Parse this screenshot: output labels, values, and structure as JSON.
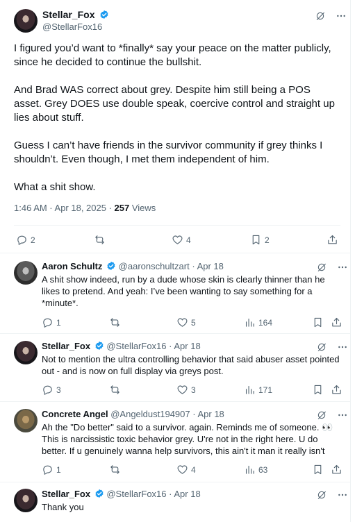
{
  "main_post": {
    "name": "Stellar_Fox",
    "handle": "@StellarFox16",
    "paragraphs": [
      "I figured you’d want to *finally* say your peace on the matter publicly, since he decided to continue the bullshit.",
      "And Brad WAS correct about grey. Despite him still being a POS asset. Grey DOES use double speak, coercive control and straight up lies about stuff.",
      "Guess I can’t have friends in the survivor community if grey thinks I shouldn’t. Even though, I met them independent of him.",
      "What a shit show."
    ],
    "timestamp": "1:46 AM · Apr 18, 2025 · ",
    "views_count": "257",
    "views_label": " Views",
    "replies": "2",
    "reposts": "",
    "likes": "4",
    "bookmarks": "2"
  },
  "replies": [
    {
      "name": "Aaron Schultz",
      "handle": "@aaronschultzart",
      "date": "· Apr 18",
      "text": "A shit show indeed, run by a dude whose skin is clearly thinner than he likes to pretend. And yeah: I’ve been wanting to say something for a *minute*.",
      "replies": "1",
      "reposts": "",
      "likes": "5",
      "views": "164"
    },
    {
      "name": "Stellar_Fox",
      "handle": "@StellarFox16",
      "date": "· Apr 18",
      "text": "Not to mention the ultra controlling behavior that said abuser asset pointed out - and is now on full display via greys post.",
      "replies": "3",
      "reposts": "",
      "likes": "3",
      "views": "171"
    },
    {
      "name": "Concrete Angel",
      "handle": "@Angeldust194907",
      "date": "· Apr 18",
      "text": "Ah the \"Do better\" said to a survivor. again. Reminds me of someone. 👀 This is narcissistic toxic behavior grey. U're not in the right here. U do better. If u genuinely wanna help survivors, this ain't it man it really isn't",
      "replies": "1",
      "reposts": "",
      "likes": "4",
      "views": "63"
    },
    {
      "name": "Stellar_Fox",
      "handle": "@StellarFox16",
      "date": "· Apr 18",
      "text": "Thank you"
    }
  ],
  "colors": {
    "verified": "#1d9bf0",
    "text": "#0f1419",
    "muted": "#536471",
    "divider": "#eff3f4"
  },
  "icons": [
    "verified-icon",
    "grok-icon",
    "more-icon",
    "reply-icon",
    "repost-icon",
    "like-icon",
    "bookmark-icon",
    "share-icon",
    "views-icon"
  ]
}
